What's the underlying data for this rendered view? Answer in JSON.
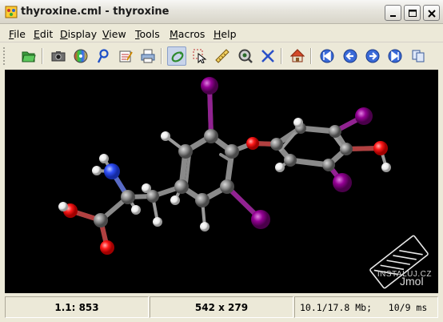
{
  "window": {
    "title": "thyroxine.cml - thyroxine",
    "icon": "jmol-app-icon",
    "controls": [
      "minimize-icon",
      "maximize-icon",
      "close-icon"
    ]
  },
  "menubar": {
    "items": [
      {
        "label": "File",
        "mnemonic": "F"
      },
      {
        "label": "Edit",
        "mnemonic": "E"
      },
      {
        "label": "Display",
        "mnemonic": "D"
      },
      {
        "label": "View",
        "mnemonic": "V"
      },
      {
        "label": "Tools",
        "mnemonic": "T"
      },
      {
        "label": "Macros",
        "mnemonic": "M"
      },
      {
        "label": "Help",
        "mnemonic": "H"
      }
    ]
  },
  "toolbar": {
    "buttons": [
      "open-folder-icon",
      "screenshot-camera-icon",
      "cd-export-icon",
      "pov-render-icon",
      "script-editor-icon",
      "print-icon",
      "rotate-icon",
      "select-icon",
      "measure-ruler-icon",
      "pick-center-icon",
      "label-atoms-icon",
      "home-icon",
      "first-frame-icon",
      "previous-frame-icon",
      "next-frame-icon",
      "last-frame-icon",
      "copy-icon"
    ],
    "active": "rotate-icon"
  },
  "viewport": {
    "background": "#000000",
    "molecule": "thyroxine",
    "colors": {
      "carbon": "#808080",
      "hydrogen": "#ffffff",
      "oxygen": "#ff0d0d",
      "nitrogen": "#3050f8",
      "iodine": "#940094"
    }
  },
  "statusbar": {
    "atom_info": "1.1: 853",
    "dimensions": "542 x 279",
    "memory": "10.1/17.8 Mb;",
    "fps": "10/9 ms"
  },
  "watermark": "INSTALUJ.CZ",
  "logo_text": "Jmol"
}
